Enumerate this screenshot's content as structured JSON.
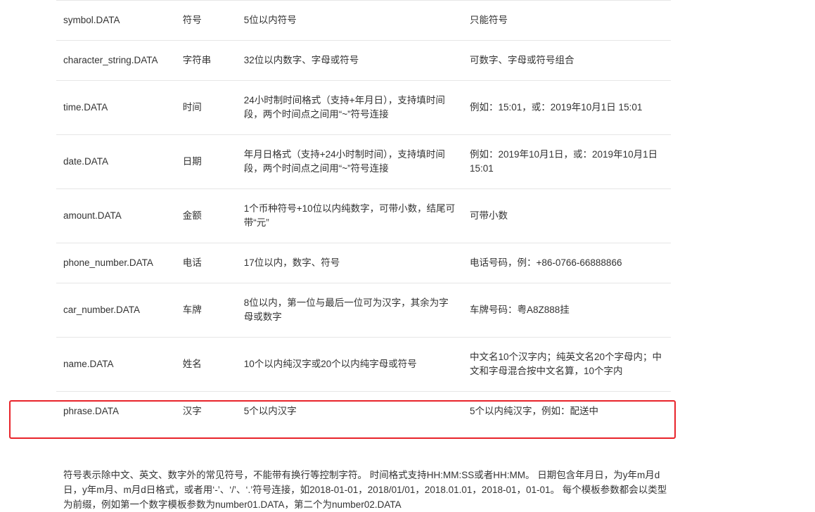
{
  "rows": [
    {
      "name": "symbol.DATA",
      "type": "符号",
      "rule": "5位以内符号",
      "note": "只能符号"
    },
    {
      "name": "character_string.DATA",
      "type": "字符串",
      "rule": "32位以内数字、字母或符号",
      "note": "可数字、字母或符号组合"
    },
    {
      "name": "time.DATA",
      "type": "时间",
      "rule": "24小时制时间格式（支持+年月日），支持填时间段，两个时间点之间用“~”符号连接",
      "note": "例如：15:01，或：2019年10月1日 15:01"
    },
    {
      "name": "date.DATA",
      "type": "日期",
      "rule": "年月日格式（支持+24小时制时间），支持填时间段，两个时间点之间用“~”符号连接",
      "note": "例如：2019年10月1日，或：2019年10月1日 15:01"
    },
    {
      "name": "amount.DATA",
      "type": "金额",
      "rule": "1个币种符号+10位以内纯数字，可带小数，结尾可带“元”",
      "note": "可带小数"
    },
    {
      "name": "phone_number.DATA",
      "type": "电话",
      "rule": "17位以内，数字、符号",
      "note": "电话号码，例：+86-0766-66888866"
    },
    {
      "name": "car_number.DATA",
      "type": "车牌",
      "rule": "8位以内，第一位与最后一位可为汉字，其余为字母或数字",
      "note": "车牌号码：粤A8Z888挂"
    },
    {
      "name": "name.DATA",
      "type": "姓名",
      "rule": "10个以内纯汉字或20个以内纯字母或符号",
      "note": "中文名10个汉字内；纯英文名20个字母内；中文和字母混合按中文名算，10个字内"
    },
    {
      "name": "phrase.DATA",
      "type": "汉字",
      "rule": "5个以内汉字",
      "note": "5个以内纯汉字，例如：配送中"
    }
  ],
  "footnote": "符号表示除中文、英文、数字外的常见符号，不能带有换行等控制字符。 时间格式支持HH:MM:SS或者HH:MM。 日期包含年月日，为y年m月d日，y年m月、m月d日格式，或者用‘-’、‘/’、‘.’符号连接，如2018-01-01，2018/01/01，2018.01.01，2018-01，01-01。 每个模板参数都会以类型为前缀，例如第一个数字模板参数为number01.DATA，第二个为number02.DATA",
  "highlight_color": "#e8232a"
}
